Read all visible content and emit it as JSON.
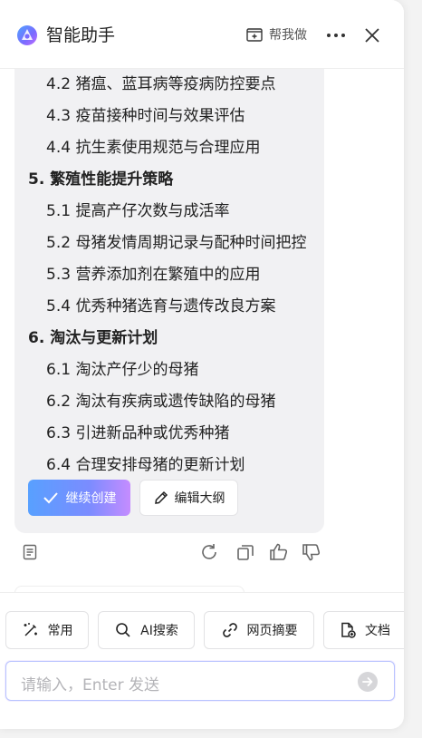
{
  "header": {
    "title": "智能助手",
    "help_label": "帮我做"
  },
  "outline": {
    "items": [
      {
        "text": "4.2 猪瘟、蓝耳病等疫病防控要点",
        "level": "sub"
      },
      {
        "text": "4.3 疫苗接种时间与效果评估",
        "level": "sub"
      },
      {
        "text": "4.4 抗生素使用规范与合理应用",
        "level": "sub"
      },
      {
        "text": "5. 繁殖性能提升策略",
        "level": "section"
      },
      {
        "text": "5.1 提高产仔次数与成活率",
        "level": "sub"
      },
      {
        "text": "5.2 母猪发情周期记录与配种时间把控",
        "level": "sub"
      },
      {
        "text": "5.3 营养添加剂在繁殖中的应用",
        "level": "sub"
      },
      {
        "text": "5.4 优秀种猪选育与遗传改良方案",
        "level": "sub"
      },
      {
        "text": "6. 淘汰与更新计划",
        "level": "section"
      },
      {
        "text": "6.1 淘汰产仔少的母猪",
        "level": "sub"
      },
      {
        "text": "6.2 淘汰有疾病或遗传缺陷的母猪",
        "level": "sub"
      },
      {
        "text": "6.3 引进新品种或优秀种猪",
        "level": "sub"
      },
      {
        "text": "6.4 合理安排母猪的更新计划",
        "level": "sub"
      }
    ],
    "continue_label": "继续创建",
    "edit_label": "编辑大纲"
  },
  "chips": [
    {
      "label": "常用",
      "icon": "magic-wand-icon"
    },
    {
      "label": "AI搜索",
      "icon": "search-icon"
    },
    {
      "label": "网页摘要",
      "icon": "link-icon"
    },
    {
      "label": "文档",
      "icon": "document-add-icon"
    }
  ],
  "input": {
    "placeholder": "请输入，Enter 发送"
  },
  "colors": {
    "accent_gradient_start": "#58a0ff",
    "accent_gradient_end": "#c58cff",
    "card_bg": "#f1f1f3"
  }
}
